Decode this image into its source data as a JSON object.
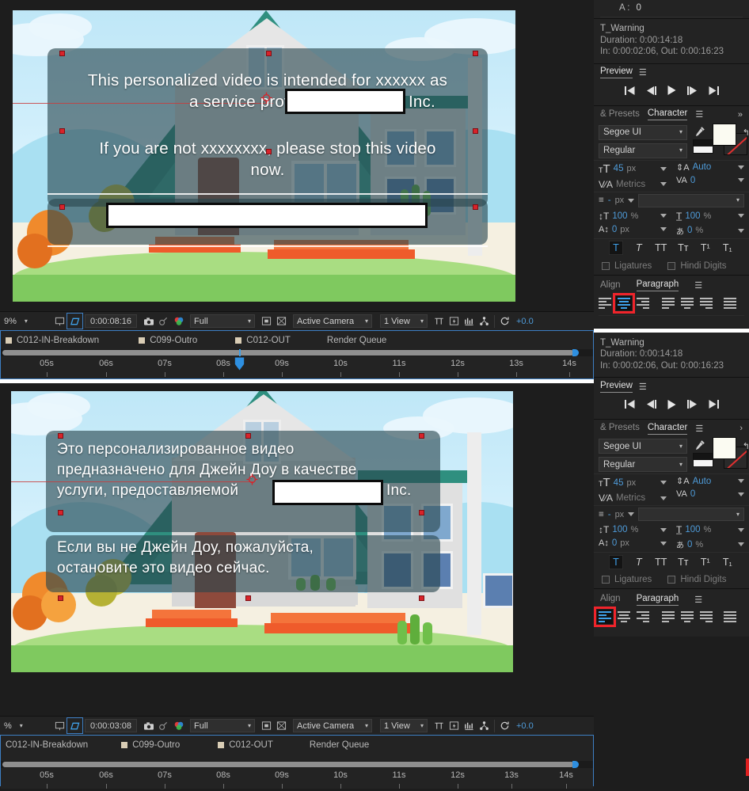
{
  "app": {
    "name": "Adobe After Effects"
  },
  "colors": {
    "accent_blue": "#3fa0e8",
    "highlight_red": "#f0242b",
    "panel_bg": "#232323",
    "handle_red": "#d8232a"
  },
  "comp_top": {
    "lines": [
      "This personalized video is intended for xxxxxx as",
      "a service provided by",
      "Inc.",
      "If you are not xxxxxxxx, please stop this video",
      "now."
    ],
    "alignment": "center"
  },
  "comp_bottom": {
    "lines": [
      "Это персонализированное видео",
      "предназначено для Джейн Доу в качестве",
      "услуги, предоставляемой",
      "Inc.",
      " Если вы не Джейн Доу, пожалуйста,",
      "остановите это видео сейчас."
    ],
    "alignment": "left"
  },
  "viewer_toolbar_top": {
    "zoom": "9%",
    "timecode": "0:00:08:16",
    "resolution": "Full",
    "camera": "Active Camera",
    "views": "1 View",
    "exposure": "+0.0",
    "icons": [
      "region-of-interest-icon",
      "transparency-grid-icon",
      "snapshot-icon",
      "show-snapshot-icon",
      "channels-icon",
      "toggle-mask-icon",
      "toggle-alpha-icon",
      "grid-guides-icon",
      "fast-previews-icon",
      "timeline-icon",
      "comp-flowchart-icon",
      "reset-exposure-icon"
    ]
  },
  "viewer_toolbar_bottom": {
    "zoom": "%",
    "timecode": "0:00:03:08",
    "resolution": "Full",
    "camera": "Active Camera",
    "views": "1 View",
    "exposure": "+0.0"
  },
  "timeline_top": {
    "tabs": [
      {
        "label": "C012-IN-Breakdown",
        "swatch": true
      },
      {
        "label": "C099-Outro",
        "swatch": true
      },
      {
        "label": "C012-OUT",
        "swatch": true
      },
      {
        "label": "Render Queue",
        "swatch": false
      }
    ],
    "ruler_labels": [
      "05s",
      "06s",
      "07s",
      "08s",
      "09s",
      "10s",
      "11s",
      "12s",
      "13s",
      "14s"
    ],
    "playhead_label": "08s"
  },
  "timeline_bottom": {
    "tabs": [
      {
        "label": "C012-IN-Breakdown",
        "swatch": false
      },
      {
        "label": "C099-Outro",
        "swatch": true
      },
      {
        "label": "C012-OUT",
        "swatch": true
      },
      {
        "label": "Render Queue",
        "swatch": false
      }
    ],
    "ruler_labels": [
      "05s",
      "06s",
      "07s",
      "08s",
      "09s",
      "10s",
      "11s",
      "12s",
      "13s",
      "14s"
    ]
  },
  "info_panel_top": {
    "audio_label": "A :",
    "audio_value": "0",
    "layer_name": "T_Warning",
    "duration": "Duration: 0:00:14:18",
    "inout": "In: 0:00:02:06, Out: 0:00:16:23"
  },
  "info_panel_bottom": {
    "layer_name": "T_Warning",
    "duration": "Duration: 0:00:14:18",
    "inout": "In: 0:00:02:06, Out: 0:00:16:23"
  },
  "preview_panel": {
    "title": "Preview",
    "buttons": [
      "first-frame-icon",
      "previous-frame-icon",
      "play-icon",
      "next-frame-icon",
      "last-frame-icon"
    ]
  },
  "character_panel": {
    "tab_left": "Presets",
    "tab_left_prefix": "&",
    "tab_active": "Character",
    "font_family": "Segoe UI",
    "font_style": "Regular",
    "font_size": "45",
    "font_size_unit": "px",
    "leading": "Auto",
    "kerning_label": "Metrics",
    "tracking": "0",
    "stroke_width": "-",
    "stroke_width_unit": "px",
    "stroke_type": "",
    "vertical_scale": "100",
    "vertical_scale_unit": "%",
    "horizontal_scale": "100",
    "horizontal_scale_unit": "%",
    "baseline_shift": "0",
    "baseline_shift_unit": "px",
    "tsume": "0",
    "tsume_unit": "%",
    "style_buttons": [
      "T",
      "T",
      "TT",
      "Tт",
      "T¹",
      "T₁"
    ],
    "style_active_index": 0,
    "ligatures_label": "Ligatures",
    "hindi_digits_label": "Hindi Digits"
  },
  "paragraph_panel": {
    "tab_left": "Align",
    "tab_active": "Paragraph",
    "align_buttons": [
      "align-left-icon",
      "align-center-icon",
      "align-right-icon",
      "justify-last-left-icon",
      "justify-last-center-icon",
      "justify-last-right-icon",
      "justify-all-icon"
    ],
    "top_active_index": 1,
    "bottom_active_index": 0
  }
}
